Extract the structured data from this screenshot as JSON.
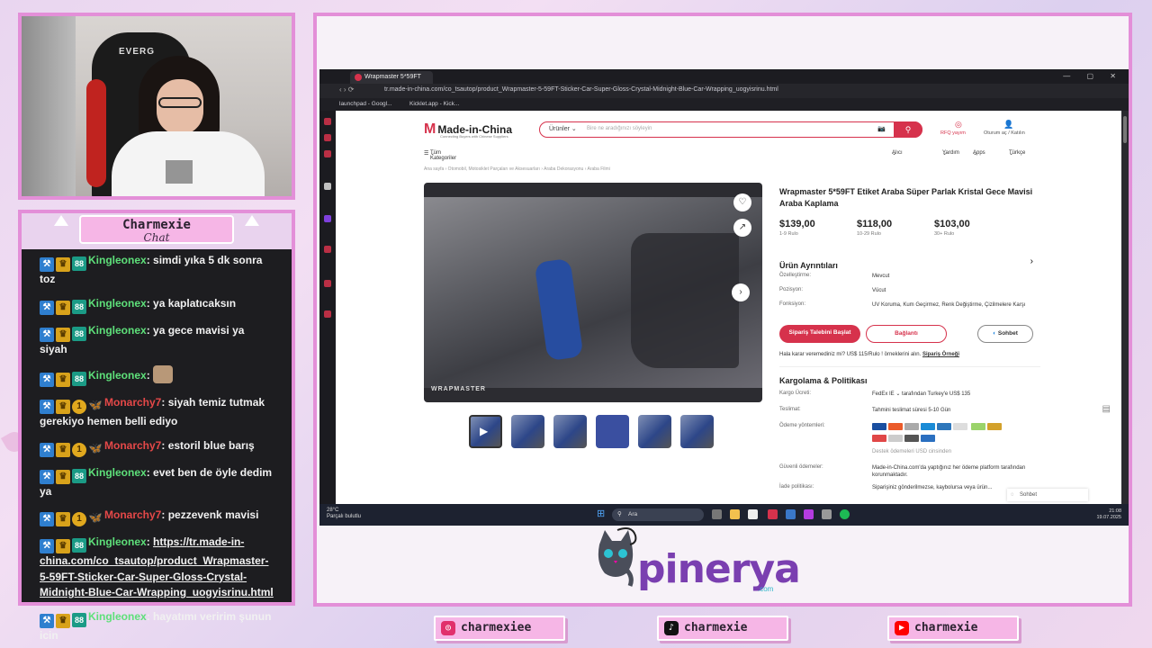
{
  "chat": {
    "title": "Charmexie",
    "subtitle": "Chat",
    "messages": [
      {
        "user": "Kingleonex",
        "text": "simdi yıka 5 dk sonra toz",
        "badges": [
          "hammer",
          "crown",
          "88"
        ],
        "type": "king"
      },
      {
        "user": "Kingleonex",
        "text": "ya kaplatıcaksın",
        "badges": [
          "hammer",
          "crown",
          "88"
        ],
        "type": "king"
      },
      {
        "user": "Kingleonex",
        "text": "ya gece mavisi ya siyah",
        "badges": [
          "hammer",
          "crown",
          "88"
        ],
        "type": "king"
      },
      {
        "user": "Kingleonex",
        "text": "",
        "badges": [
          "hammer",
          "crown",
          "88"
        ],
        "type": "king-emote"
      },
      {
        "user": "Monarchy7",
        "text": "siyah temiz tutmak gerekiyo hemen belli ediyo",
        "badges": [
          "hammer",
          "crown",
          "one",
          "fly"
        ],
        "type": "mon"
      },
      {
        "user": "Monarchy7",
        "text": "estoril blue barış",
        "badges": [
          "hammer",
          "crown",
          "one",
          "fly"
        ],
        "type": "mon"
      },
      {
        "user": "Kingleonex",
        "text": "evet ben de öyle dedim ya",
        "badges": [
          "hammer",
          "crown",
          "88"
        ],
        "type": "king"
      },
      {
        "user": "Monarchy7",
        "text": "pezzevenk mavisi",
        "badges": [
          "hammer",
          "crown",
          "one",
          "fly"
        ],
        "type": "mon"
      },
      {
        "user": "Kingleonex",
        "text": "https://tr.made-in-china.com/co_tsautop/product_Wrapmaster-5-59FT-Sticker-Car-Super-Gloss-Crystal-Midnight-Blue-Car-Wrapping_uogyisrinu.html",
        "badges": [
          "hammer",
          "crown",
          "88"
        ],
        "type": "king-link"
      },
      {
        "user": "Kingleonex",
        "text": "hayatımı veririm şunun icin",
        "badges": [
          "hammer",
          "crown",
          "88"
        ],
        "type": "king"
      }
    ]
  },
  "webcam": {
    "chair_brand": "EVERG"
  },
  "browser": {
    "tab_title": "Wrapmaster 5*59FT",
    "url": "tr.made-in-china.com/co_tsautop/product_Wrapmaster-5-59FT-Sticker-Car-Super-Gloss-Crystal-Midnight-Blue-Car-Wrapping_uogyisrinu.html",
    "bookmarks": [
      "launchpad - Googl...",
      "Kicklet.app - Kick..."
    ]
  },
  "site": {
    "logo": "Made-in-China",
    "logo_tagline": "Connecting Buyers with Chinese Suppliers",
    "search_category": "Ürünler",
    "search_placeholder": "Bire ne aradığınızı söyleyin",
    "rfq": "RFQ yayım",
    "account": "Oturum aç / Katılın",
    "all_categories": "Tüm Kategoriler",
    "nav": [
      "Alıcı",
      "Yardım",
      "Apps",
      "Türkçe"
    ],
    "breadcrumb": "Ana sayfa  ›  Otomobil, Motosiklet Parçaları ve Aksesuarları  ›  Araba Dekorasyonu  ›  Araba Filmi",
    "gallery_logo": "WRAPMASTER"
  },
  "product": {
    "title": "Wrapmaster 5*59FT Etiket Araba Süper Parlak Kristal Gece Mavisi Araba Kaplama",
    "prices": [
      {
        "price": "$139,00",
        "qty": "1-9 Rulo"
      },
      {
        "price": "$118,00",
        "qty": "10-29 Rulo"
      },
      {
        "price": "$103,00",
        "qty": "30+ Rulo"
      }
    ],
    "details_title": "Ürün Ayrıntıları",
    "details": [
      {
        "k": "Özelleştirme:",
        "v": "Mevcut"
      },
      {
        "k": "Pozisyon:",
        "v": "Vücut"
      },
      {
        "k": "Fonksiyon:",
        "v": "UV Koruma, Kum Geçirmez, Renk Değiştirme, Çizilmelere Karşı"
      }
    ],
    "btn_order": "Sipariş Talebini Başlat",
    "btn_contact": "Bağlantı",
    "btn_chat": "Sohbet",
    "sample_text": "Hala karar veremediniz mi? US$ 115/Rulo ! örneklerini alın.",
    "sample_link": "Sipariş Örneği",
    "shipping_title": "Kargolama & Politikası",
    "shipping": [
      {
        "k": "Kargo Ücreti:",
        "v": "FedEx IE  ⌄   tarafından Turkey'e US$ 135"
      },
      {
        "k": "Teslimat:",
        "v": "Tahmini teslimat süresi 5-10 Gün"
      },
      {
        "k": "Ödeme yöntemleri:",
        "v": ""
      },
      {
        "k": "",
        "v": "Destek ödemeleri USD cinsinden"
      },
      {
        "k": "Güvenli ödemeler:",
        "v": "Made-in-China.com'da yaptığınız her ödeme platform tarafından korunmaktadır."
      },
      {
        "k": "İade politikası:",
        "v": "Siparişiniz gönderilmezse, kaybolursa veya ürün..."
      }
    ],
    "sohbet_tip": "Sohbet"
  },
  "taskbar": {
    "temp": "28°C",
    "weather": "Parçalı bulutlu",
    "search": "Ara",
    "time": "21:08",
    "date": "19.07.2025"
  },
  "sponsor": {
    "name": "pinerya",
    "tld": ".com"
  },
  "socials": [
    {
      "handle": "charmexiee",
      "icon": "instagram-icon",
      "color": "#e1306c"
    },
    {
      "handle": "charmexie",
      "icon": "tiktok-icon",
      "color": "#111111"
    },
    {
      "handle": "charmexie",
      "icon": "youtube-icon",
      "color": "#ff0000"
    }
  ],
  "colors": {
    "frame": "#e38fd8",
    "accent": "#d6324c",
    "king": "#5ee07a",
    "mon": "#e54848"
  }
}
